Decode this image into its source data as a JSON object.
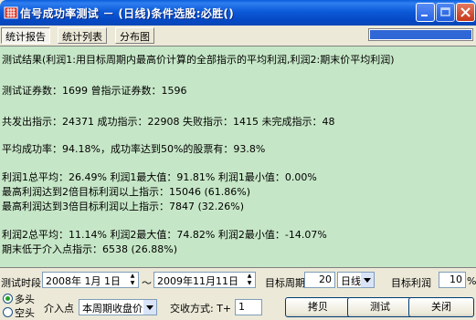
{
  "window": {
    "title": "信号成功率测试 － (日线)条件选股:必胜()"
  },
  "toolbar": {
    "tabs": [
      {
        "label": "统计报告",
        "active": true
      },
      {
        "label": "统计列表",
        "active": false
      },
      {
        "label": "分布图",
        "active": false
      }
    ],
    "progress_fraction": 1.0
  },
  "report": {
    "lines": [
      "测试结果(利润1:用目标周期内最高价计算的全部指示的平均利润,利润2:期末价平均利润)",
      "测试证券数：1699          曾指示证券数：1596",
      "共发出指示：24371   成功指示：22908   失败指示：1415   未完成指示：48",
      "平均成功率：94.18%，成功率达到50%的股票有：93.8%",
      "利润1总平均：26.49%   利润1最大值：91.81%   利润1最小值：0.00%",
      "最高利润达到2倍目标利润以上指示：15046 (61.86%)",
      "最高利润达到3倍目标利润以上指示：7847 (32.26%)",
      "利润2总平均：11.14%   利润2最大值：74.82%   利润2最小值：-14.07%",
      "期末低于介入点指示：6538 (26.88%)"
    ]
  },
  "controls": {
    "period_label": "测试时段",
    "start_date": "2008年 1月 1日",
    "end_date": "2009年11月11日",
    "target_period_label": "目标周期",
    "target_period_value": "20",
    "period_unit": "日线",
    "target_profit_label": "目标利润",
    "target_profit_value": "10",
    "percent_sign": "%",
    "long_label": "多头",
    "short_label": "空头",
    "entry_label": "介入点",
    "entry_value": "本周期收盘价",
    "trade_label": "交收方式: T+",
    "trade_value": "1",
    "copy_button": "拷贝",
    "test_button": "测试",
    "close_button": "关闭"
  },
  "colors": {
    "report_bg": "#c6e7c7",
    "titlebar": "#0a5ddb",
    "face": "#ece9d8"
  }
}
